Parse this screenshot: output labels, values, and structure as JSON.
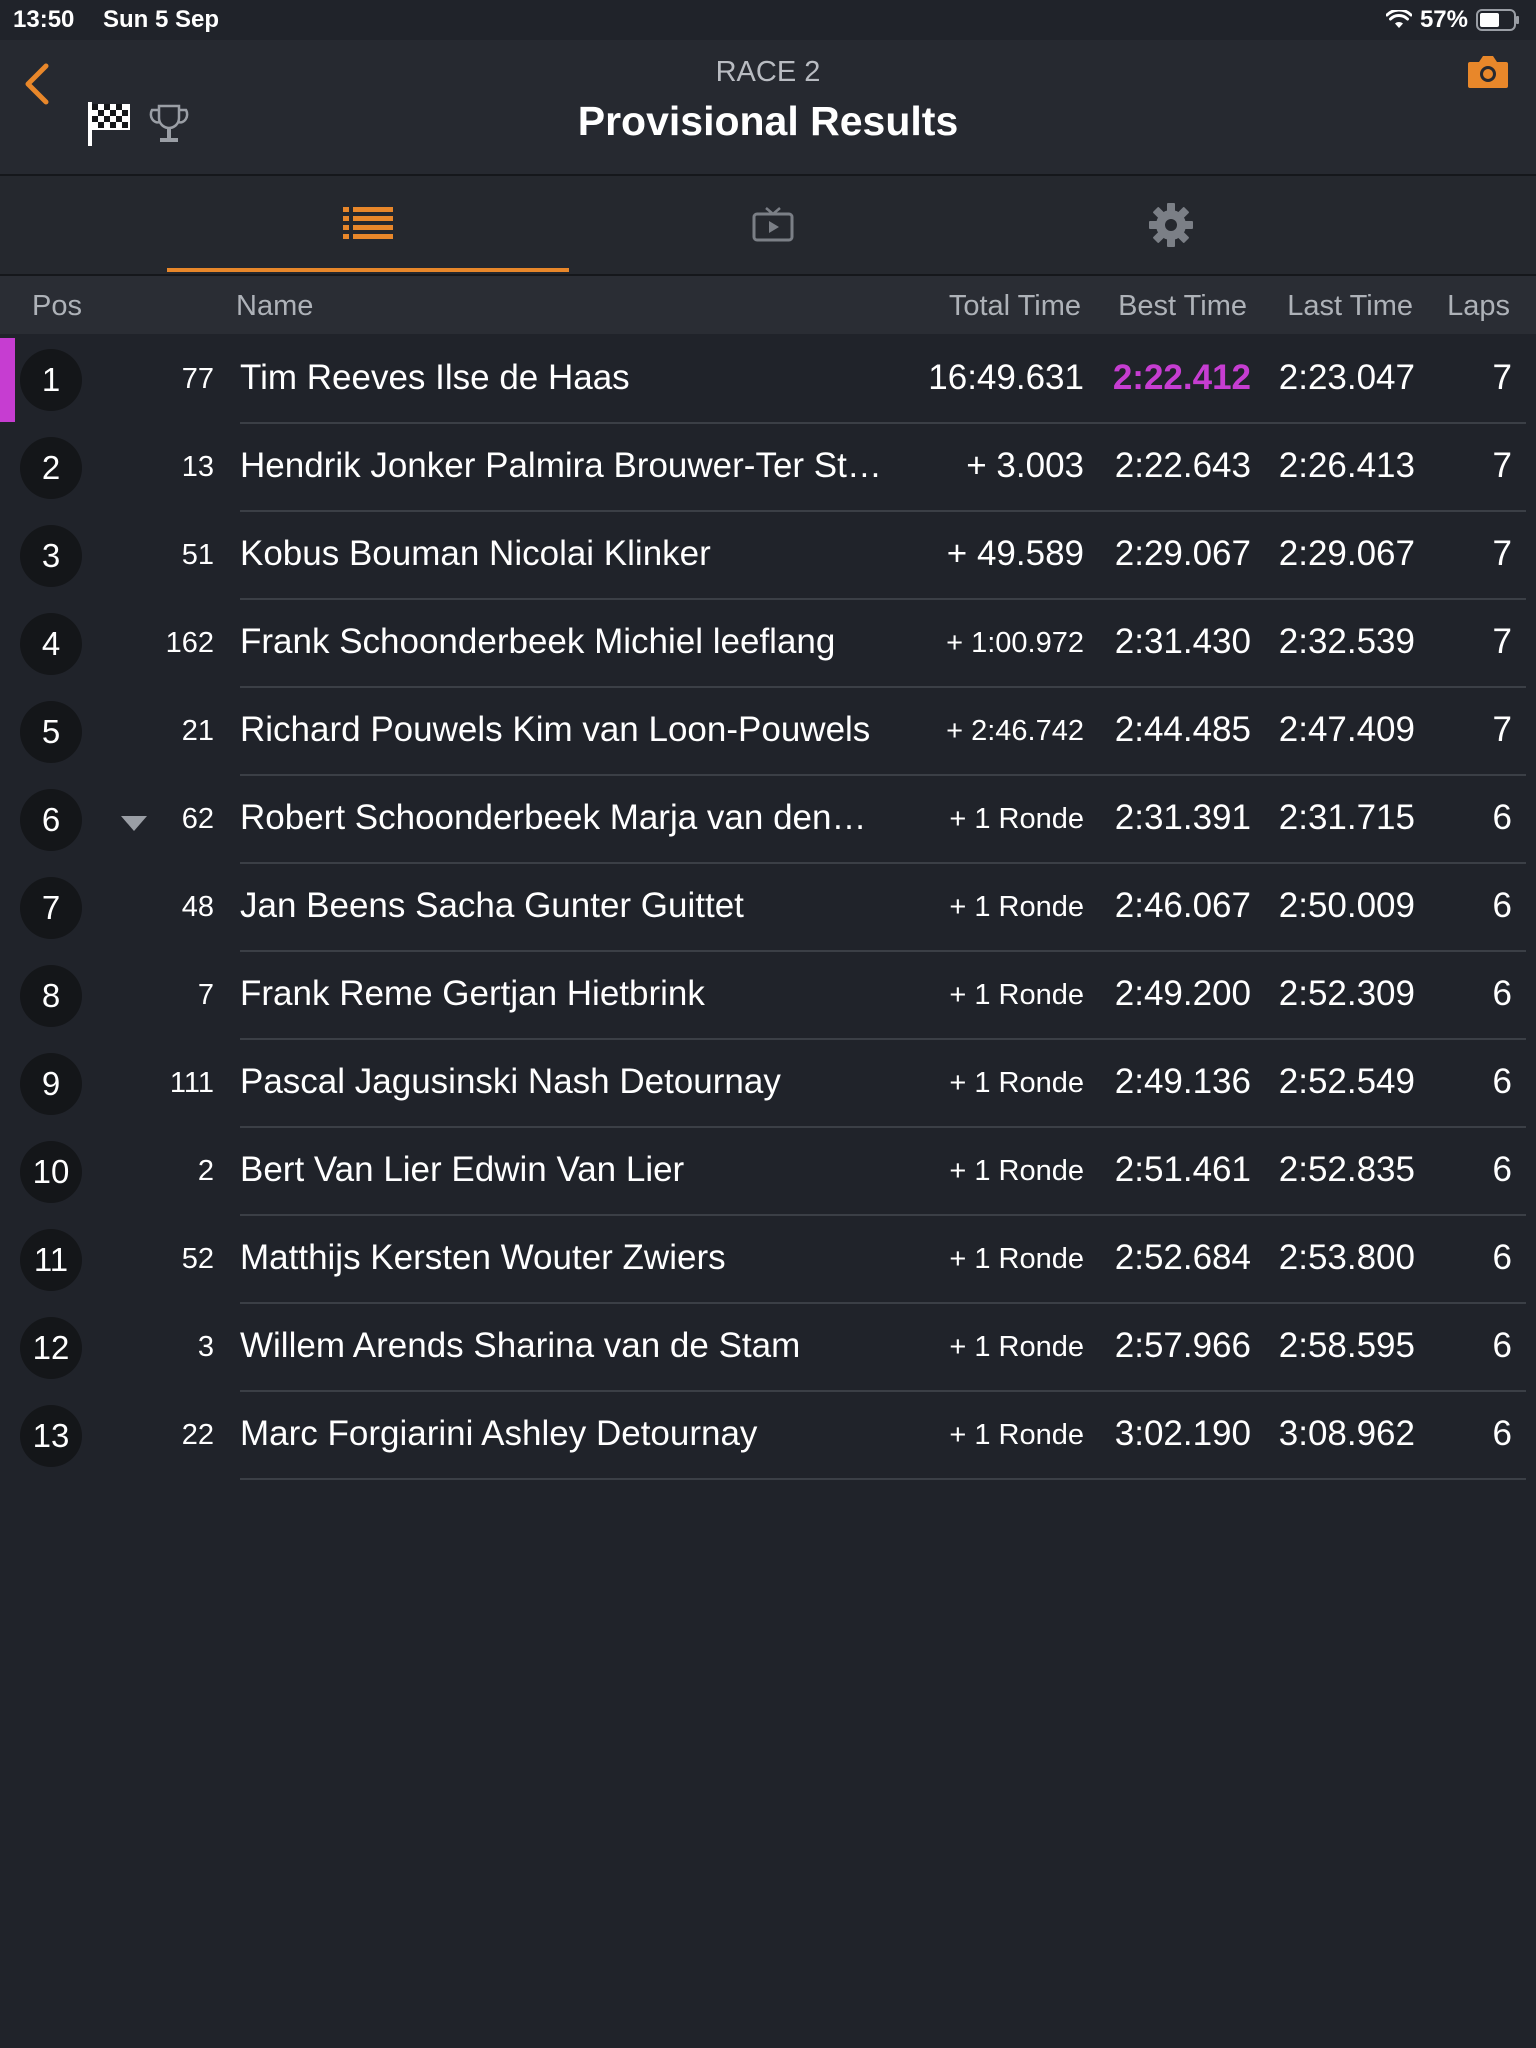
{
  "status": {
    "time": "13:50",
    "date": "Sun 5 Sep",
    "battery": "57%"
  },
  "header": {
    "subtitle": "RACE 2",
    "title": "Provisional Results"
  },
  "colors": {
    "accent": "#e8872a",
    "fastest": "#c63dd1",
    "background": "#20232a"
  },
  "tabs": [
    {
      "icon": "list-icon",
      "active": true
    },
    {
      "icon": "tv-icon",
      "active": false
    },
    {
      "icon": "gear-icon",
      "active": false
    }
  ],
  "columns": {
    "pos": "Pos",
    "name": "Name",
    "total": "Total Time",
    "best": "Best Time",
    "last": "Last Time",
    "laps": "Laps"
  },
  "rows": [
    {
      "pos": "1",
      "num": "77",
      "name": "Tim Reeves Ilse de Haas",
      "total": "16:49.631",
      "best": "2:22.412",
      "last": "2:23.047",
      "laps": "7",
      "fastest": true
    },
    {
      "pos": "2",
      "num": "13",
      "name": "Hendrik Jonker Palmira Brouwer-Ter St…",
      "total": "+ 3.003",
      "best": "2:22.643",
      "last": "2:26.413",
      "laps": "7"
    },
    {
      "pos": "3",
      "num": "51",
      "name": "Kobus Bouman Nicolai Klinker",
      "total": "+ 49.589",
      "best": "2:29.067",
      "last": "2:29.067",
      "laps": "7"
    },
    {
      "pos": "4",
      "num": "162",
      "name": "Frank Schoonderbeek Michiel leeflang",
      "total": "+ 1:00.972",
      "best": "2:31.430",
      "last": "2:32.539",
      "laps": "7",
      "small": true
    },
    {
      "pos": "5",
      "num": "21",
      "name": "Richard Pouwels Kim van Loon-Pouwels",
      "total": "+ 2:46.742",
      "best": "2:44.485",
      "last": "2:47.409",
      "laps": "7",
      "small": true
    },
    {
      "pos": "6",
      "num": "62",
      "name": "Robert Schoonderbeek Marja van den…",
      "total": "+ 1 Ronde",
      "best": "2:31.391",
      "last": "2:31.715",
      "laps": "6",
      "small": true,
      "dropped": true
    },
    {
      "pos": "7",
      "num": "48",
      "name": "Jan Beens Sacha Gunter Guittet",
      "total": "+ 1 Ronde",
      "best": "2:46.067",
      "last": "2:50.009",
      "laps": "6",
      "small": true
    },
    {
      "pos": "8",
      "num": "7",
      "name": "Frank Reme Gertjan Hietbrink",
      "total": "+ 1 Ronde",
      "best": "2:49.200",
      "last": "2:52.309",
      "laps": "6",
      "small": true
    },
    {
      "pos": "9",
      "num": "111",
      "name": "Pascal Jagusinski Nash Detournay",
      "total": "+ 1 Ronde",
      "best": "2:49.136",
      "last": "2:52.549",
      "laps": "6",
      "small": true
    },
    {
      "pos": "10",
      "num": "2",
      "name": "Bert Van Lier Edwin Van Lier",
      "total": "+ 1 Ronde",
      "best": "2:51.461",
      "last": "2:52.835",
      "laps": "6",
      "small": true
    },
    {
      "pos": "11",
      "num": "52",
      "name": "Matthijs Kersten Wouter Zwiers",
      "total": "+ 1 Ronde",
      "best": "2:52.684",
      "last": "2:53.800",
      "laps": "6",
      "small": true
    },
    {
      "pos": "12",
      "num": "3",
      "name": "Willem Arends Sharina van de Stam",
      "total": "+ 1 Ronde",
      "best": "2:57.966",
      "last": "2:58.595",
      "laps": "6",
      "small": true
    },
    {
      "pos": "13",
      "num": "22",
      "name": "Marc Forgiarini Ashley Detournay",
      "total": "+ 1 Ronde",
      "best": "3:02.190",
      "last": "3:08.962",
      "laps": "6",
      "small": true
    }
  ]
}
